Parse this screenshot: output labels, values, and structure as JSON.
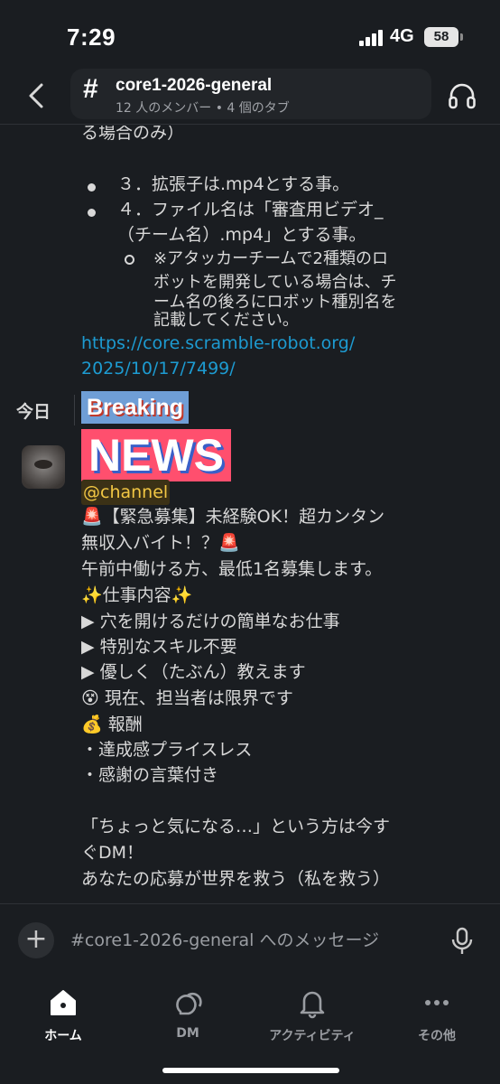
{
  "status": {
    "time": "7:29",
    "network": "4G",
    "battery": "58"
  },
  "header": {
    "channel_name": "core1-2026-general",
    "meta": "12 人のメンバー • 4 個のタブ"
  },
  "previous_message": {
    "continuation": "る場合のみ）",
    "items": [
      "３．拡張子は.mp4とする事。",
      "４．ファイル名は「審査用ビデオ_",
      "（チーム名）.mp4」とする事。"
    ],
    "sub_note_lines": [
      "※アタッカーチームで2種類のロ",
      "ボットを開発している場合は、チ",
      "ーム名の後ろにロボット種別名を",
      "記載してください。"
    ],
    "link_lines": [
      "https://core.scramble-robot.org/",
      "2025/10/17/7499/"
    ]
  },
  "today_label": "今日",
  "new_message": {
    "breaking": "Breaking",
    "news": "NEWS",
    "mention": "@channel",
    "lines": [
      "🚨【緊急募集】未経験OK！超カンタン",
      "無収入バイト！？🚨",
      "午前中働ける方、最低1名募集します。",
      "✨仕事内容✨",
      "▶ 穴を開けるだけの簡単なお仕事",
      "▶ 特別なスキル不要",
      "▶ 優しく（たぶん）教えます",
      "😵 現在、担当者は限界です",
      "💰 報酬",
      "・達成感プライスレス",
      "・感謝の言葉付き",
      "",
      "「ちょっと気になる…」という方は今す",
      "ぐDM！",
      "あなたの応募が世界を救う（私を救う）"
    ]
  },
  "composer": {
    "placeholder": "#core1-2026-general へのメッセージ"
  },
  "tabs": [
    {
      "label": "ホーム",
      "icon": "home-icon",
      "active": true
    },
    {
      "label": "DM",
      "icon": "dm-icon",
      "active": false
    },
    {
      "label": "アクティビティ",
      "icon": "bell-icon",
      "active": false
    },
    {
      "label": "その他",
      "icon": "more-icon",
      "active": false
    }
  ],
  "colors": {
    "background": "#1a1d21",
    "link": "#1d9bd1",
    "mention": "#f2c744",
    "news_bg": "#ff4f6e",
    "breaking_bg": "#6f9ed6"
  }
}
